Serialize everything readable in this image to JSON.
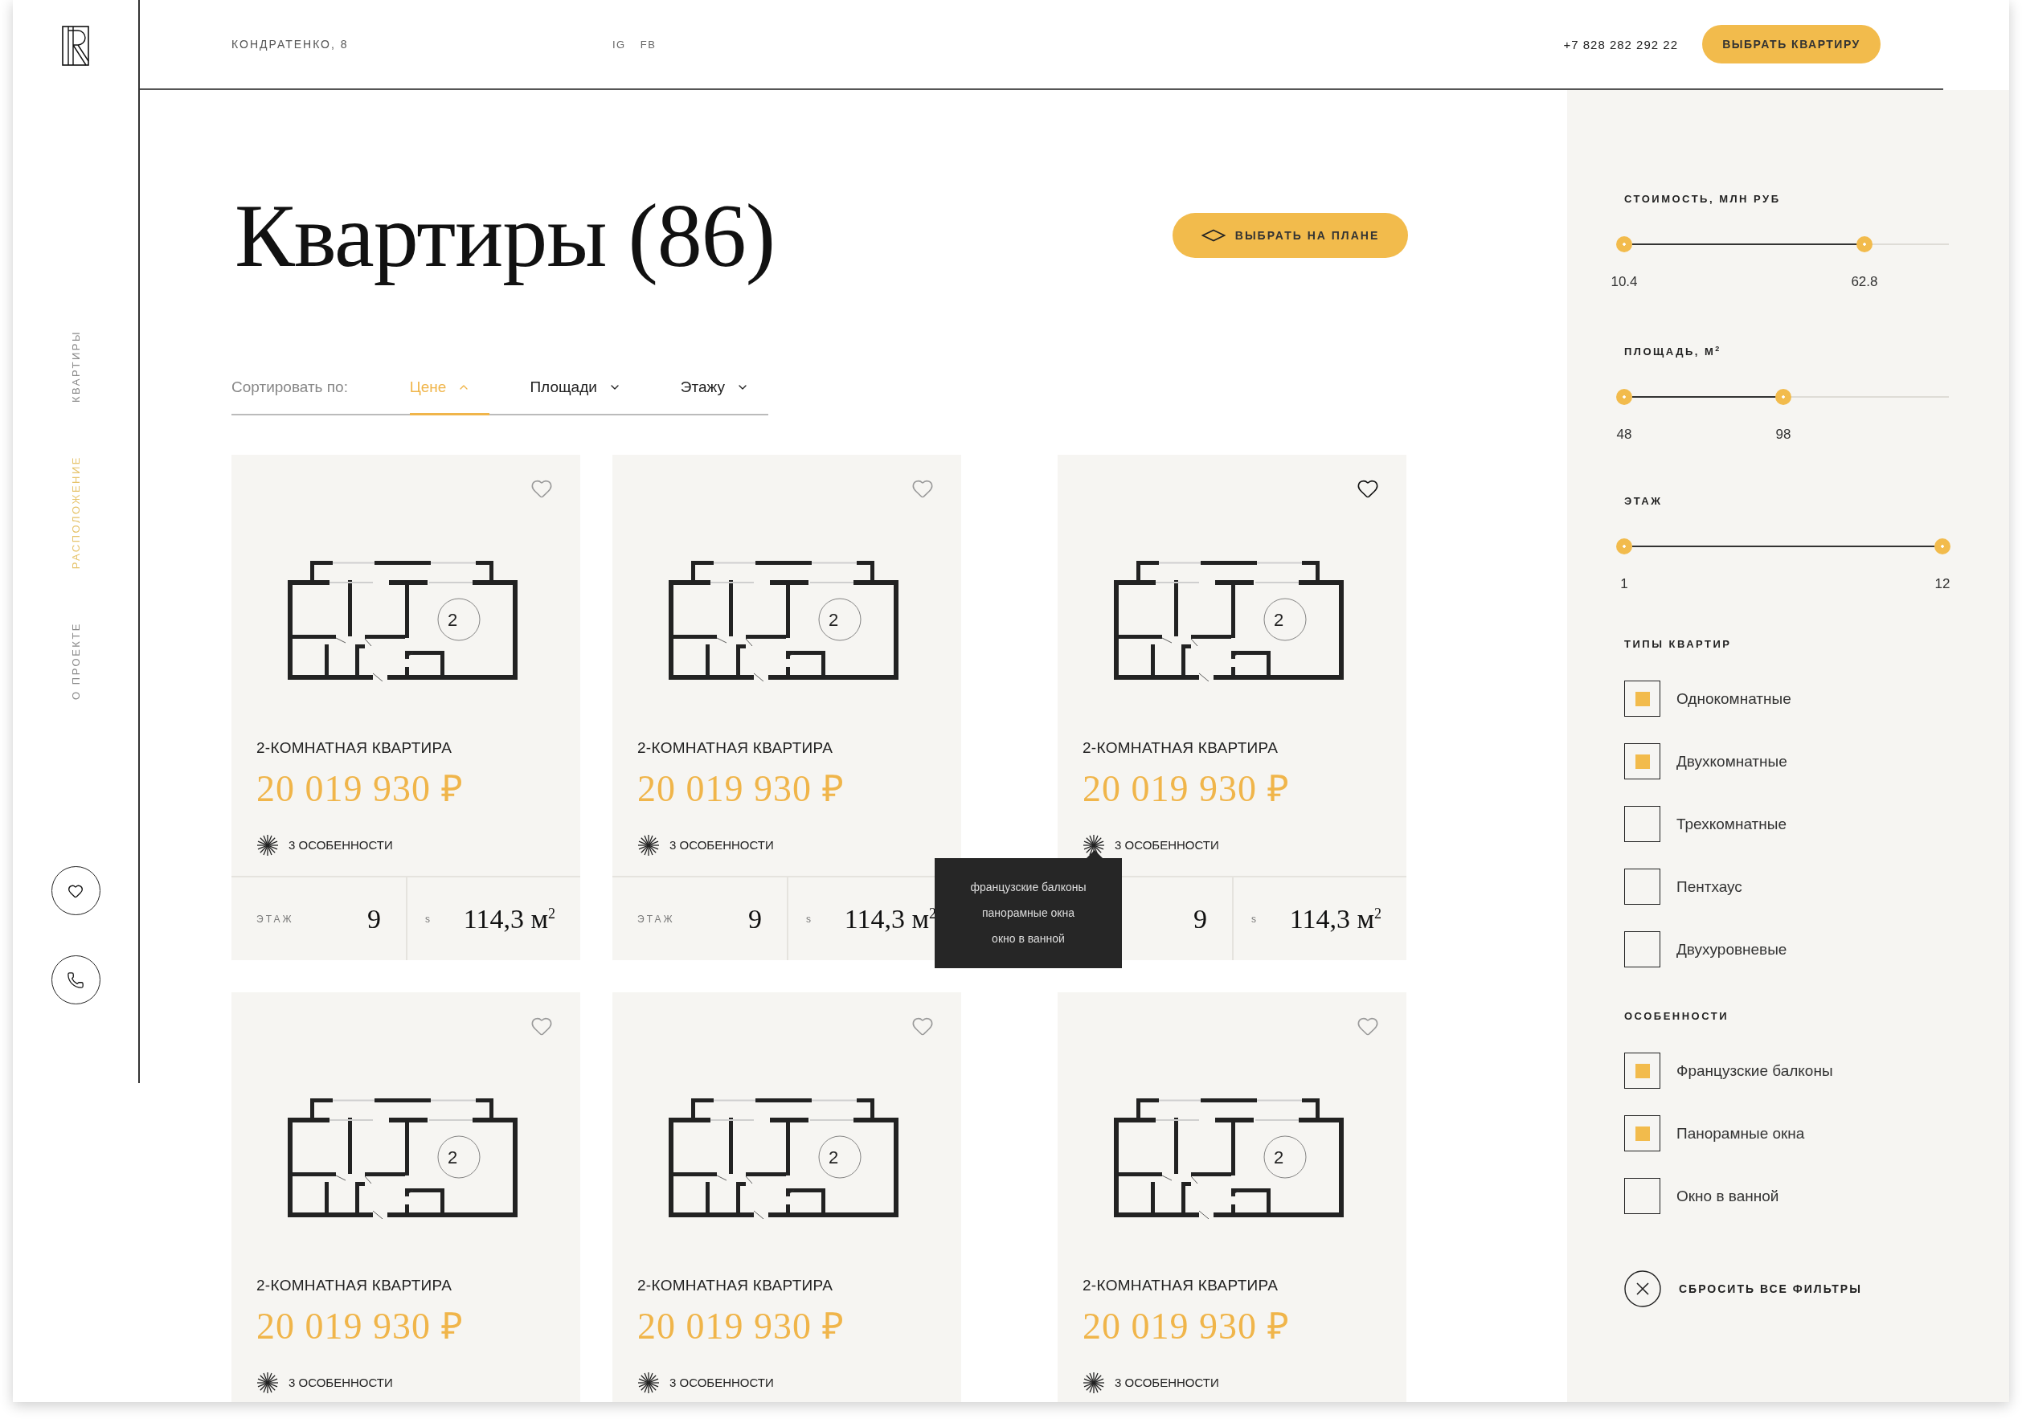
{
  "sidebar": {
    "nav": [
      {
        "label": "КВАРТИРЫ",
        "selected": false
      },
      {
        "label": "РАСПОЛОЖЕНИЕ",
        "selected": true
      },
      {
        "label": "О ПРОЕКТЕ",
        "selected": false
      }
    ]
  },
  "header": {
    "address": "КОНДРАТЕНКО, 8",
    "socials": [
      "IG",
      "FB"
    ],
    "phone": "+7 828 282 292 22",
    "cta": "ВЫБРАТЬ КВАРТИРУ"
  },
  "title": "Квартиры (86)",
  "plan_button": "ВЫБРАТЬ НА ПЛАНЕ",
  "sort": {
    "label": "Сортировать по:",
    "options": [
      {
        "label": "Цене",
        "selected": true,
        "ascending": true
      },
      {
        "label": "Площади",
        "selected": false,
        "ascending": false
      },
      {
        "label": "Этажу",
        "selected": false,
        "ascending": false
      }
    ]
  },
  "cards": [
    {
      "favorite": false,
      "plan": {
        "rooms": "2"
      },
      "title": "2-КОМНАТНАЯ КВАРТИРА",
      "price": "20 019 930 ₽",
      "features": "3 ОСОБЕННОСТИ",
      "floor_label": "ЭТАЖ",
      "floor": "9",
      "area_label": "s",
      "area": "114,3 м$^{2}$"
    },
    {
      "favorite": false,
      "plan": {
        "rooms": "2"
      },
      "title": "2-КОМНАТНАЯ КВАРТИРА",
      "price": "20 019 930 ₽",
      "features": "3 ОСОБЕННОСТИ",
      "floor_label": "ЭТАЖ",
      "floor": "9",
      "area_label": "s",
      "area": "114,3 м$^{2}$"
    },
    {
      "favorite": true,
      "plan": {
        "rooms": "2"
      },
      "title": "2-КОМНАТНАЯ КВАРТИРА",
      "price": "20 019 930 ₽",
      "features": "3 ОСОБЕННОСТИ",
      "tooltip": [
        "французские балконы",
        "панорамные окна",
        "окно в ванной"
      ],
      "floor": "9",
      "area_label": "s",
      "area": "114,3 м$^{2}$"
    },
    {
      "favorite": false,
      "plan": {
        "rooms": "2"
      },
      "title": "2-КОМНАТНАЯ КВАРТИРА",
      "price": "20 019 930 ₽",
      "features": "3 ОСОБЕННОСТИ"
    },
    {
      "favorite": false,
      "plan": {
        "rooms": "2"
      },
      "title": "2-КОМНАТНАЯ КВАРТИРА",
      "price": "20 019 930 ₽",
      "features": "3 ОСОБЕННОСТИ"
    },
    {
      "favorite": false,
      "plan": {
        "rooms": "2"
      },
      "title": "2-КОМНАТНАЯ КВАРТИРА",
      "price": "20 019 930 ₽",
      "features": "3 ОСОБЕННОСТИ"
    }
  ],
  "filters": {
    "sliders": [
      {
        "label": "СТОИМОСТЬ, МЛН РУБ",
        "thumbs": [
          {
            "level": 0,
            "reading": "10.4"
          },
          {
            "level": 0.74,
            "reading": "62.8"
          }
        ]
      },
      {
        "label": "ПЛОЩАДЬ, М$^{2}$",
        "thumbs": [
          {
            "level": 0,
            "reading": "48"
          },
          {
            "level": 0.49,
            "reading": "98"
          }
        ]
      },
      {
        "label": "ЭТАЖ",
        "thumbs": [
          {
            "level": 0,
            "reading": "1"
          },
          {
            "level": 0.98,
            "reading": "12"
          }
        ]
      }
    ],
    "groups": [
      {
        "label": "ТИПЫ КВАРТИР",
        "options": [
          {
            "label": "Однокомнатные",
            "checked": true
          },
          {
            "label": "Двухкомнатные",
            "checked": true
          },
          {
            "label": "Трехкомнатные",
            "checked": false
          },
          {
            "label": "Пентхаус",
            "checked": false
          },
          {
            "label": "Двухуровневые",
            "checked": false
          }
        ]
      },
      {
        "label": "ОСОБЕННОСТИ",
        "options": [
          {
            "label": "Французские балконы",
            "checked": true
          },
          {
            "label": "Панорамные окна",
            "checked": true
          },
          {
            "label": "Окно в ванной",
            "checked": false
          }
        ]
      }
    ],
    "reset": "СБРОСИТЬ ВСЕ ФИЛЬТРЫ"
  }
}
